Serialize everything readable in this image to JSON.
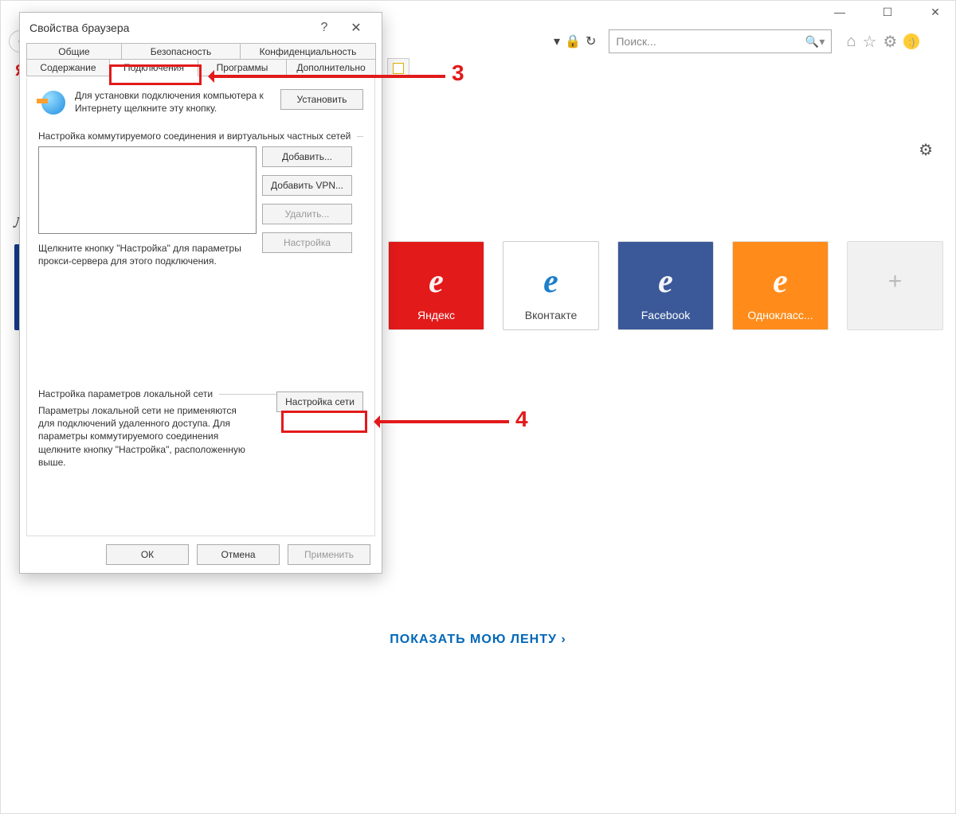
{
  "window": {
    "minimize": "—",
    "maximize": "☐",
    "close": "✕"
  },
  "toolbar": {
    "lock": "🔒",
    "refresh": "↻",
    "search_placeholder": "Поиск...",
    "icons": {
      "home": "⌂",
      "star": "☆",
      "gear": "⚙",
      "smile": ":)"
    }
  },
  "page": {
    "gear": "⚙",
    "tiles": [
      {
        "label": "Яндекс",
        "class": "tile-red"
      },
      {
        "label": "Вконтакте",
        "class": "tile-white"
      },
      {
        "label": "Facebook",
        "class": "tile-blue"
      },
      {
        "label": "Однокласс...",
        "class": "tile-orange"
      }
    ],
    "add": "+",
    "feed": "ПОКАЗАТЬ МОЮ ЛЕНТУ ›"
  },
  "dialog": {
    "title": "Свойства браузера",
    "help": "?",
    "close": "✕",
    "tabs_top": [
      "Общие",
      "Безопасность",
      "Конфиденциальность"
    ],
    "tabs_bottom": [
      "Содержание",
      "Подключения",
      "Программы",
      "Дополнительно"
    ],
    "setup_text": "Для установки подключения компьютера к Интернету щелкните эту кнопку.",
    "install": "Установить",
    "dial_label": "Настройка коммутируемого соединения и виртуальных частных сетей",
    "add": "Добавить...",
    "add_vpn": "Добавить VPN...",
    "delete": "Удалить...",
    "settings": "Настройка",
    "proxy_hint": "Щелкните кнопку \"Настройка\" для параметры прокси-сервера для этого подключения.",
    "lan_label": "Настройка параметров локальной сети",
    "lan_text": "Параметры локальной сети не применяются для подключений удаленного доступа. Для параметры коммутируемого соединения щелкните кнопку \"Настройка\", расположенную выше.",
    "lan_btn": "Настройка сети",
    "ok": "ОК",
    "cancel": "Отмена",
    "apply": "Применить"
  },
  "annot": {
    "n3": "3",
    "n4": "4"
  },
  "glyph": {
    "ie": "e",
    "y": "Я",
    "l": "Л"
  }
}
